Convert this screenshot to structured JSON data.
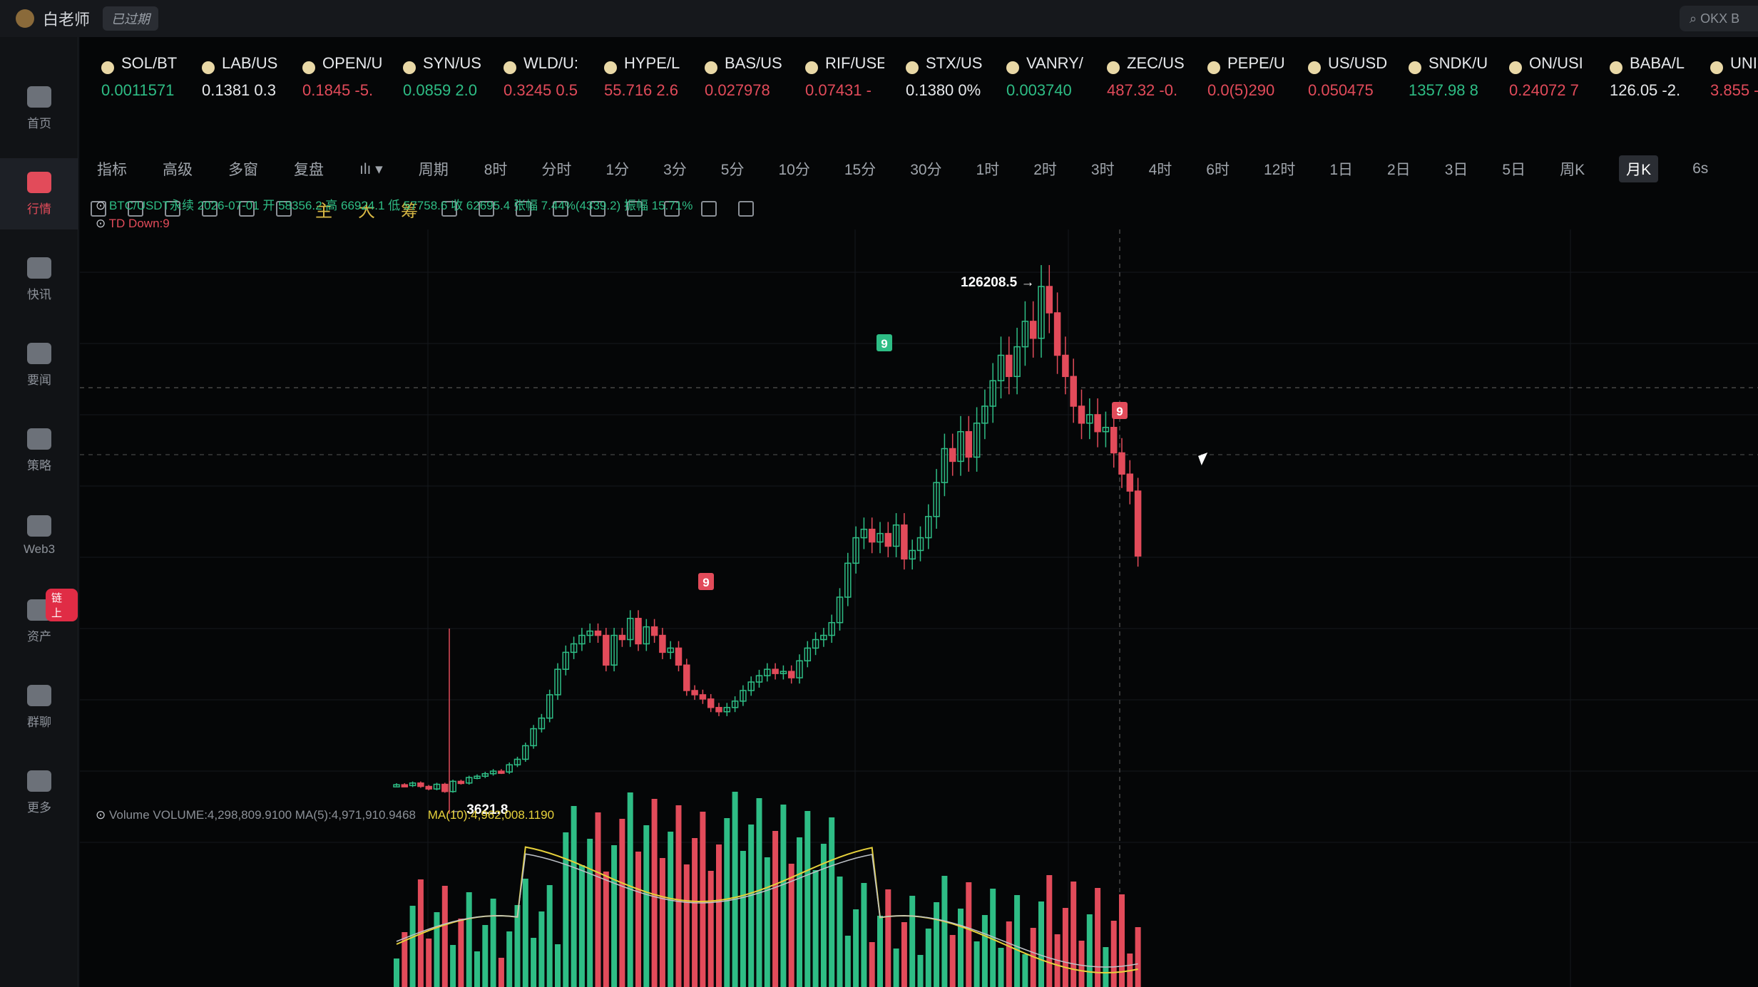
{
  "top": {
    "user": "白老师",
    "badge": "已过期",
    "search": "OKX B"
  },
  "sidebar": [
    {
      "label": "首页",
      "name": "sidebar-item-home"
    },
    {
      "label": "行情",
      "name": "sidebar-item-market",
      "active": true
    },
    {
      "label": "快讯",
      "name": "sidebar-item-flash"
    },
    {
      "label": "要闻",
      "name": "sidebar-item-news"
    },
    {
      "label": "策略",
      "name": "sidebar-item-strategy"
    },
    {
      "label": "Web3",
      "name": "sidebar-item-web3"
    },
    {
      "label": "资产",
      "name": "sidebar-item-assets",
      "tag": "链上"
    },
    {
      "label": "群聊",
      "name": "sidebar-item-chat"
    },
    {
      "label": "更多",
      "name": "sidebar-item-more"
    }
  ],
  "tickers": [
    {
      "sym": "SOL/BT",
      "px": "0.0011571",
      "c": "up"
    },
    {
      "sym": "LAB/US",
      "px": "0.1381 0.3",
      "c": "wh"
    },
    {
      "sym": "OPEN/U",
      "px": "0.1845 -5.",
      "c": "dn"
    },
    {
      "sym": "SYN/US",
      "px": "0.0859 2.0",
      "c": "up"
    },
    {
      "sym": "WLD/U:",
      "px": "0.3245 0.5",
      "c": "dn"
    },
    {
      "sym": "HYPE/L",
      "px": "55.716 2.6",
      "c": "dn"
    },
    {
      "sym": "BAS/US",
      "px": "0.027978",
      "c": "dn"
    },
    {
      "sym": "RIF/USE",
      "px": "0.07431 -",
      "c": "dn"
    },
    {
      "sym": "STX/US",
      "px": "0.1380 0%",
      "c": "wh"
    },
    {
      "sym": "VANRY/",
      "px": "0.003740",
      "c": "up"
    },
    {
      "sym": "ZEC/US",
      "px": "487.32 -0.",
      "c": "dn"
    },
    {
      "sym": "PEPE/U",
      "px": "0.0(5)290",
      "c": "dn"
    },
    {
      "sym": "US/USD",
      "px": "0.050475",
      "c": "dn"
    },
    {
      "sym": "SNDK/U",
      "px": "1357.98 8",
      "c": "up"
    },
    {
      "sym": "ON/USI",
      "px": "0.24072 7",
      "c": "dn"
    },
    {
      "sym": "BABA/L",
      "px": "126.05 -2.",
      "c": "wh"
    },
    {
      "sym": "UNI",
      "px": "3.855 -",
      "c": "dn"
    }
  ],
  "toolbar": {
    "indicator": "指标",
    "advanced": "高级",
    "multi": "多窗",
    "replay": "复盘",
    "cycle": "周期"
  },
  "periods": [
    "8时",
    "分时",
    "1分",
    "3分",
    "5分",
    "10分",
    "15分",
    "30分",
    "1时",
    "2时",
    "3时",
    "4时",
    "6时",
    "12时",
    "1日",
    "2日",
    "3日",
    "5日",
    "周K",
    "月K",
    "6s"
  ],
  "active_period": "月K",
  "drawing": {
    "main": "主",
    "big": "大",
    "chip": "筹"
  },
  "info": {
    "line1": "BTC/USDT永续 2026-07-01 开 58356.2 高 66924.1 低 57758.6 收 62695.4 张幅 7.44%(4339.2) 振幅 15.71%",
    "line2": "TD  Down:9",
    "volume": "Volume  VOLUME:4,298,809.9100  MA(5):4,971,910.9468",
    "ma10": "MA(10):4,962,008.1190",
    "high_label": "126208.5 →",
    "low_label": "← 3621.8",
    "td_marks": [
      "9",
      "9",
      "9"
    ]
  },
  "chart_data": {
    "type": "candlestick",
    "series": [
      {
        "name": "BTC/USDT永续",
        "values": [
          8800,
          8600,
          9200,
          8400,
          7800,
          8900,
          7200,
          9600,
          9200,
          10500,
          10800,
          11400,
          12000,
          11800,
          13500,
          14800,
          18000,
          22000,
          24500,
          30000,
          36000,
          40000,
          42000,
          44000,
          45000,
          44000,
          37000,
          44000,
          43000,
          48000,
          42000,
          46000,
          44000,
          40000,
          41000,
          37000,
          31000,
          30000,
          29000,
          27000,
          26000,
          27000,
          28500,
          31000,
          33000,
          34500,
          36000,
          35000,
          35500,
          34000,
          38000,
          41000,
          43000,
          44000,
          47000,
          53000,
          61000,
          67000,
          69000,
          66000,
          68000,
          65000,
          70000,
          62000,
          64000,
          67000,
          72000,
          80000,
          88000,
          85000,
          92000,
          86000,
          94000,
          98000,
          104000,
          110000,
          105000,
          112000,
          118000,
          114000,
          126208,
          120000,
          110000,
          105000,
          98000,
          94000,
          96000,
          92000,
          93000,
          87000,
          82000,
          78000,
          62695
        ]
      }
    ],
    "low": 3621.8,
    "high": 126208.5
  }
}
